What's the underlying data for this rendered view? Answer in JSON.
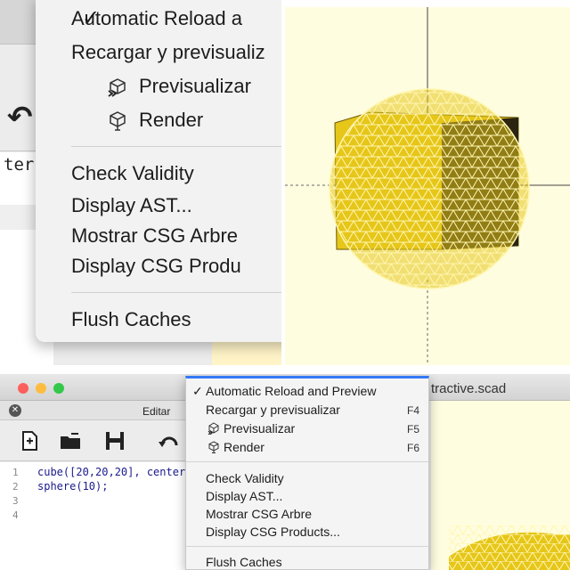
{
  "top_menu": {
    "items": [
      {
        "label": "Automatic Reload a",
        "checked": true
      },
      {
        "label": "Recargar y previsualiz"
      },
      {
        "label": "Previsualizar",
        "icon": "preview-cube-icon"
      },
      {
        "label": "Render",
        "icon": "render-cube-icon"
      },
      {
        "label": "Check Validity"
      },
      {
        "label": "Display AST..."
      },
      {
        "label": "Mostrar CSG Arbre"
      },
      {
        "label": "Display CSG Produ"
      },
      {
        "label": "Flush Caches"
      }
    ],
    "check_mark": "✓",
    "editor_text": "ter"
  },
  "window": {
    "title": "tractive.scad",
    "panel_title": "Editar",
    "close_glyph": "✕",
    "traffic_lights": {
      "close": "#fc605c",
      "minimize": "#fdbc40",
      "zoom": "#34c84a"
    }
  },
  "toolbar": {
    "tools": [
      {
        "name": "new-file-icon"
      },
      {
        "name": "open-folder-icon"
      },
      {
        "name": "save-icon"
      },
      {
        "name": "undo-icon"
      }
    ]
  },
  "editor": {
    "line_numbers": [
      "1",
      "2",
      "3",
      "4"
    ],
    "lines": [
      "cube([20,20,20], center",
      "sphere(10);",
      "",
      ""
    ]
  },
  "menu": {
    "check_mark": "✓",
    "items": [
      {
        "label": "Automatic Reload and Preview",
        "checked": true,
        "shortcut": ""
      },
      {
        "label": "Recargar y previsualizar",
        "shortcut": "F4"
      },
      {
        "label": "Previsualizar",
        "shortcut": "F5",
        "icon": "preview-cube-icon"
      },
      {
        "label": "Render",
        "shortcut": "F6",
        "icon": "render-cube-icon"
      },
      {
        "label": "Check Validity",
        "shortcut": ""
      },
      {
        "label": "Display AST...",
        "shortcut": ""
      },
      {
        "label": "Mostrar CSG Arbre",
        "shortcut": ""
      },
      {
        "label": "Display CSG Products...",
        "shortcut": ""
      },
      {
        "label": "Flush Caches",
        "shortcut": ""
      }
    ]
  },
  "colors": {
    "model_fill": "#e6c619",
    "model_shadow": "#2a2410",
    "wireframe": "#fff6b0",
    "viewport_bg": "#fffde0",
    "selection_accent": "#3478f6"
  }
}
